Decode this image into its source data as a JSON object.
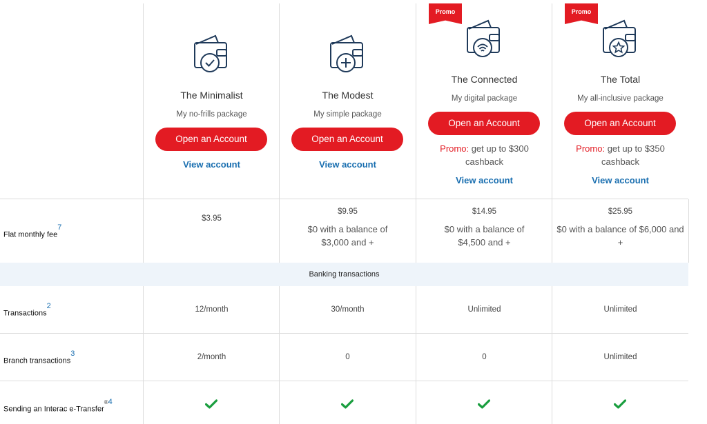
{
  "colors": {
    "accent": "#e31b23",
    "link": "#1a6fb0",
    "band": "#eef4fa",
    "check": "#1a9e3f"
  },
  "packages": [
    {
      "name": "The Minimalist",
      "subtitle": "My no-frills package",
      "button": "Open an Account",
      "view": "View account",
      "icon": "wallet-check-icon",
      "promo_tag": "",
      "promo_label": "",
      "promo_text": "",
      "fee": "$3.95",
      "fee_waiver": ""
    },
    {
      "name": "The Modest",
      "subtitle": "My simple package",
      "button": "Open an Account",
      "view": "View account",
      "icon": "wallet-plus-icon",
      "promo_tag": "",
      "promo_label": "",
      "promo_text": "",
      "fee": "$9.95",
      "fee_waiver": "$0 with a balance of $3,000 and +"
    },
    {
      "name": "The Connected",
      "subtitle": "My digital package",
      "button": "Open an Account",
      "view": "View account",
      "icon": "wallet-wifi-icon",
      "promo_tag": "Promo",
      "promo_label": "Promo:",
      "promo_text": "get up to $300 cashback",
      "fee": "$14.95",
      "fee_waiver": "$0 with a balance of $4,500 and +"
    },
    {
      "name": "The Total",
      "subtitle": "My all-inclusive package",
      "button": "Open an Account",
      "view": "View account",
      "icon": "wallet-star-icon",
      "promo_tag": "Promo",
      "promo_label": "Promo:",
      "promo_text": "get up to $350 cashback",
      "fee": "$25.95",
      "fee_waiver": "$0 with a balance of $6,000 and +"
    }
  ],
  "rows": {
    "fee": {
      "label": "Flat monthly fee",
      "note": "7"
    },
    "section": "Banking transactions",
    "transactions": {
      "label": "Transactions",
      "note": "2",
      "values": [
        "12/month",
        "30/month",
        "Unlimited",
        "Unlimited"
      ]
    },
    "branch": {
      "label": "Branch transactions",
      "note": "3",
      "values": [
        "2/month",
        "0",
        "0",
        "Unlimited"
      ]
    },
    "etransfer": {
      "label": "Sending an Interac e-Transfer",
      "mark": "®",
      "note": "4",
      "values": [
        "check-icon",
        "check-icon",
        "check-icon",
        "check-icon"
      ]
    }
  }
}
